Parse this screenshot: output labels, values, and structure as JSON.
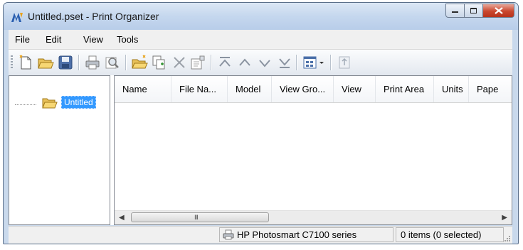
{
  "window": {
    "title": "Untitled.pset - Print Organizer",
    "controls": [
      "minimize",
      "maximize",
      "close"
    ]
  },
  "menu": [
    "File",
    "Edit",
    "View",
    "Tools"
  ],
  "toolbar": {
    "icons": [
      "new-set-icon",
      "open-icon",
      "save-icon",
      "print-icon",
      "preview-icon",
      "add-folder-icon",
      "add-files-icon",
      "delete-icon",
      "properties-icon",
      "move-top-icon",
      "move-up-icon",
      "move-down-icon",
      "move-bottom-icon",
      "view-options-icon",
      "dropdown-arrow-icon",
      "help-icon"
    ]
  },
  "tree": {
    "root_label": "Untitled"
  },
  "list": {
    "columns": [
      "Name",
      "File Na...",
      "Model",
      "View Gro...",
      "View",
      "Print Area",
      "Units",
      "Pape"
    ],
    "rows": []
  },
  "scrollbar": {
    "thumb_grip": "III"
  },
  "status": {
    "printer": "HP Photosmart C7100 series",
    "selection": "0 items (0 selected)"
  },
  "colors": {
    "selection_blue": "#3399ff",
    "titlebar": "#c5d7ee",
    "close_red": "#c9472d"
  }
}
